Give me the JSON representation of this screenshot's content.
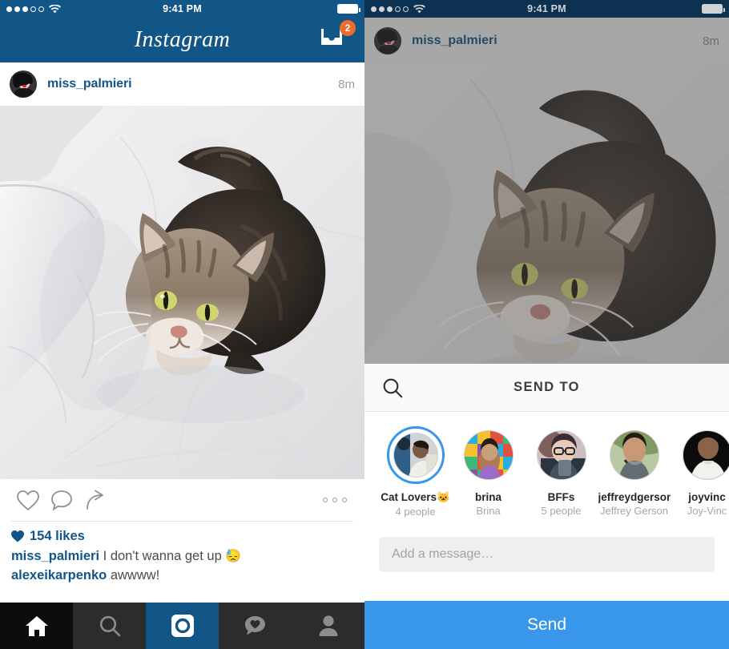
{
  "left": {
    "status": {
      "time": "9:41 PM",
      "signal_filled": 3,
      "signal_empty": 2,
      "wifi": "wifi-icon",
      "battery": "battery-icon"
    },
    "nav": {
      "brand": "Instagram",
      "inbox_icon": "inbox-tray-icon",
      "inbox_badge": "2"
    },
    "post": {
      "username": "miss_palmieri",
      "time": "8m",
      "avatar": "user-avatar",
      "photo_alt": "tabby cat curled on white bedsheets"
    },
    "actions": {
      "like": "heart-icon",
      "comment": "comment-bubble-icon",
      "share": "share-arrow-icon",
      "more": "more-options-icon"
    },
    "meta": {
      "likes_heart": "heart-filled-icon",
      "likes_text": "154 likes",
      "caption_user": "miss_palmieri",
      "caption_text": "I don't wanna get up",
      "caption_emoji": "😓",
      "comment_user": "alexeikarpenko",
      "comment_text": "awwww!"
    },
    "tabs": [
      {
        "name": "home",
        "icon": "home-icon",
        "active": true
      },
      {
        "name": "search",
        "icon": "search-icon",
        "active": false
      },
      {
        "name": "camera",
        "icon": "camera-icon",
        "active": false
      },
      {
        "name": "activity",
        "icon": "activity-heart-icon",
        "active": false
      },
      {
        "name": "profile",
        "icon": "profile-person-icon",
        "active": false
      }
    ]
  },
  "right": {
    "status": {
      "time": "9:41 PM",
      "signal_filled": 3,
      "signal_empty": 2,
      "wifi": "wifi-icon",
      "battery": "battery-icon"
    },
    "post": {
      "username": "miss_palmieri",
      "time": "8m",
      "avatar": "user-avatar"
    },
    "sheet": {
      "search_icon": "search-icon",
      "title": "SEND TO",
      "recipients": [
        {
          "name": "Cat Lovers🐱",
          "sub": "4 people",
          "selected": true,
          "avatar": "group-avatar-cat-lovers"
        },
        {
          "name": "brina",
          "sub": "Brina",
          "selected": false,
          "avatar": "user-avatar-brina"
        },
        {
          "name": "BFFs",
          "sub": "5 people",
          "selected": false,
          "avatar": "group-avatar-bffs"
        },
        {
          "name": "jeffreydgerson",
          "sub": "Jeffrey Gerson",
          "selected": false,
          "avatar": "user-avatar-jeffreydgerson"
        },
        {
          "name": "joyvinc",
          "sub": "Joy-Vinc",
          "selected": false,
          "avatar": "user-avatar-joyvinc"
        }
      ],
      "message_placeholder": "Add a message…",
      "message_value": "",
      "send_label": "Send"
    }
  },
  "colors": {
    "header_blue": "#125688",
    "link_blue": "#125688",
    "send_blue": "#3897E8",
    "badge_orange": "#ED6B2C",
    "status_dim": "#0d3251"
  }
}
